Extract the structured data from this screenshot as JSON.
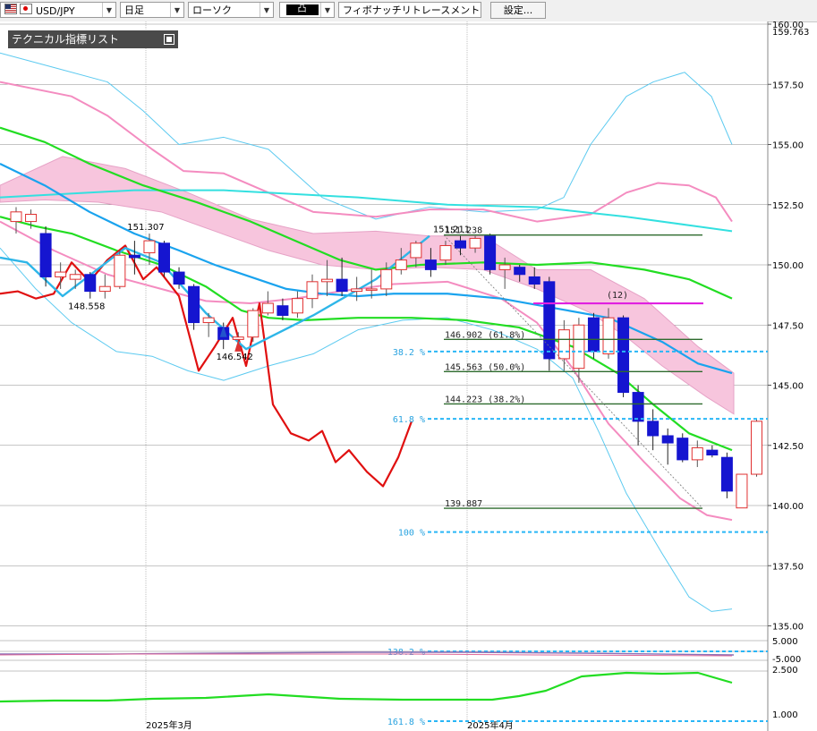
{
  "toolbar": {
    "pair": "USD/JPY",
    "timeframe": "日足",
    "chart_type": "ローソク",
    "mode": "凸",
    "tool": "フィボナッチリトレースメント",
    "settings_label": "設定..."
  },
  "panel": {
    "title": "テクニカル指標リスト"
  },
  "chart_data": {
    "type": "candlestick",
    "y_axis": {
      "min": 135.0,
      "max": 160.0,
      "ticks": [
        "160.00",
        "157.50",
        "155.00",
        "152.50",
        "150.00",
        "147.50",
        "145.00",
        "142.50",
        "140.00",
        "137.50",
        "135.00"
      ],
      "top_price_label": "159.763"
    },
    "x_axis": {
      "labels": [
        "2025年3月",
        "2025年4月"
      ]
    },
    "sub_axis": {
      "ticks": [
        "5.000",
        "-5.000",
        "2.500",
        "1.000"
      ]
    },
    "candles": [
      {
        "o": 151.8,
        "h": 152.4,
        "l": 151.3,
        "c": 152.2
      },
      {
        "o": 151.8,
        "h": 152.3,
        "l": 151.5,
        "c": 152.1
      },
      {
        "o": 151.3,
        "h": 151.6,
        "l": 149.1,
        "c": 149.5
      },
      {
        "o": 149.5,
        "h": 150.1,
        "l": 149.0,
        "c": 149.7
      },
      {
        "o": 149.4,
        "h": 149.8,
        "l": 149.0,
        "c": 149.6
      },
      {
        "o": 149.6,
        "h": 149.7,
        "l": 148.6,
        "c": 148.9
      },
      {
        "o": 148.9,
        "h": 149.6,
        "l": 148.6,
        "c": 149.1
      },
      {
        "o": 149.1,
        "h": 150.6,
        "l": 149.0,
        "c": 150.4
      },
      {
        "o": 150.4,
        "h": 151.0,
        "l": 149.6,
        "c": 150.3
      },
      {
        "o": 150.5,
        "h": 151.3,
        "l": 150.0,
        "c": 151.0
      },
      {
        "o": 150.9,
        "h": 151.0,
        "l": 149.5,
        "c": 149.7
      },
      {
        "o": 149.7,
        "h": 149.9,
        "l": 149.0,
        "c": 149.2
      },
      {
        "o": 149.1,
        "h": 149.2,
        "l": 147.3,
        "c": 147.6
      },
      {
        "o": 147.6,
        "h": 148.0,
        "l": 147.0,
        "c": 147.8
      },
      {
        "o": 147.4,
        "h": 147.6,
        "l": 146.5,
        "c": 146.9
      },
      {
        "o": 146.9,
        "h": 147.2,
        "l": 146.6,
        "c": 147.0
      },
      {
        "o": 147.0,
        "h": 148.2,
        "l": 146.8,
        "c": 148.1
      },
      {
        "o": 148.0,
        "h": 148.9,
        "l": 147.9,
        "c": 148.4
      },
      {
        "o": 148.3,
        "h": 148.6,
        "l": 147.7,
        "c": 147.9
      },
      {
        "o": 148.0,
        "h": 148.9,
        "l": 147.8,
        "c": 148.6
      },
      {
        "o": 148.6,
        "h": 149.6,
        "l": 148.2,
        "c": 149.3
      },
      {
        "o": 149.3,
        "h": 150.2,
        "l": 148.7,
        "c": 149.4
      },
      {
        "o": 149.4,
        "h": 150.3,
        "l": 148.7,
        "c": 148.9
      },
      {
        "o": 148.9,
        "h": 149.5,
        "l": 148.5,
        "c": 149.0
      },
      {
        "o": 149.0,
        "h": 149.8,
        "l": 148.6,
        "c": 149.0
      },
      {
        "o": 149.0,
        "h": 150.1,
        "l": 148.7,
        "c": 149.8
      },
      {
        "o": 149.8,
        "h": 150.7,
        "l": 149.6,
        "c": 150.2
      },
      {
        "o": 150.3,
        "h": 151.0,
        "l": 149.9,
        "c": 150.9
      },
      {
        "o": 150.2,
        "h": 150.7,
        "l": 149.5,
        "c": 149.8
      },
      {
        "o": 150.2,
        "h": 151.0,
        "l": 150.0,
        "c": 150.8
      },
      {
        "o": 151.0,
        "h": 151.2,
        "l": 150.4,
        "c": 150.7
      },
      {
        "o": 150.7,
        "h": 151.2,
        "l": 150.5,
        "c": 151.1
      },
      {
        "o": 151.2,
        "h": 151.3,
        "l": 149.6,
        "c": 149.8
      },
      {
        "o": 149.8,
        "h": 150.3,
        "l": 149.0,
        "c": 150.0
      },
      {
        "o": 149.9,
        "h": 150.0,
        "l": 149.3,
        "c": 149.6
      },
      {
        "o": 149.5,
        "h": 149.9,
        "l": 149.0,
        "c": 149.2
      },
      {
        "o": 149.3,
        "h": 149.5,
        "l": 145.6,
        "c": 146.1
      },
      {
        "o": 146.1,
        "h": 147.7,
        "l": 145.6,
        "c": 147.3
      },
      {
        "o": 145.7,
        "h": 147.8,
        "l": 145.1,
        "c": 147.5
      },
      {
        "o": 147.8,
        "h": 148.0,
        "l": 146.1,
        "c": 146.4
      },
      {
        "o": 146.3,
        "h": 148.2,
        "l": 146.1,
        "c": 147.8
      },
      {
        "o": 147.8,
        "h": 147.9,
        "l": 144.5,
        "c": 144.7
      },
      {
        "o": 144.7,
        "h": 145.0,
        "l": 142.5,
        "c": 143.5
      },
      {
        "o": 143.5,
        "h": 144.0,
        "l": 142.3,
        "c": 142.9
      },
      {
        "o": 142.9,
        "h": 143.2,
        "l": 141.7,
        "c": 142.6
      },
      {
        "o": 142.8,
        "h": 143.0,
        "l": 141.8,
        "c": 141.9
      },
      {
        "o": 141.9,
        "h": 142.7,
        "l": 141.6,
        "c": 142.4
      },
      {
        "o": 142.3,
        "h": 142.5,
        "l": 142.0,
        "c": 142.1
      },
      {
        "o": 142.0,
        "h": 142.2,
        "l": 140.3,
        "c": 140.6
      },
      {
        "o": 139.9,
        "h": 141.3,
        "l": 139.9,
        "c": 141.3
      },
      {
        "o": 141.3,
        "h": 143.6,
        "l": 141.2,
        "c": 143.5
      }
    ],
    "swing_labels": [
      {
        "text": "151.307",
        "price": 151.3,
        "bar": 9
      },
      {
        "text": "148.558",
        "price": 148.6,
        "bar": 5
      },
      {
        "text": "146.542",
        "price": 146.5,
        "bar": 15
      },
      {
        "text": "151.211",
        "price": 151.2,
        "bar": 30
      }
    ],
    "fibonacci": {
      "levels": [
        {
          "text": "151.238",
          "price": 151.238
        },
        {
          "text": "146.902 (61.8%)",
          "price": 146.902
        },
        {
          "text": "145.563 (50.0%)",
          "price": 145.563
        },
        {
          "text": "144.223 (38.2%)",
          "price": 144.223
        },
        {
          "text": "139.887",
          "price": 139.887
        }
      ],
      "extension_labels": [
        {
          "text": "38.2 %",
          "price": 146.4
        },
        {
          "text": "61.8 %",
          "price": 143.6
        },
        {
          "text": "100 %",
          "price": 138.9
        }
      ],
      "sub_extension_labels": [
        "138.2 %",
        "161.8 %"
      ],
      "marker_label": "(12)",
      "marker_price": 148.4
    }
  },
  "colors": {
    "bull_fill": "#ffffff",
    "bull_edge": "#e03030",
    "bear_fill": "#1515d0",
    "bear_edge": "#1515d0",
    "cloud": "#f7c5dd",
    "fib_line": "#2e6b2e",
    "fib_ext": "#29b6f6",
    "marker_line": "#e020e0",
    "zigzag_red": "#e01010",
    "zigzag_blue": "#2eb6e8",
    "ma_green": "#22dd22",
    "ma_blue": "#1aa3ee",
    "bb_outer": "#5ccaf0",
    "bb_pink": "#f48cc0",
    "long_ma": "#33e0e0"
  }
}
